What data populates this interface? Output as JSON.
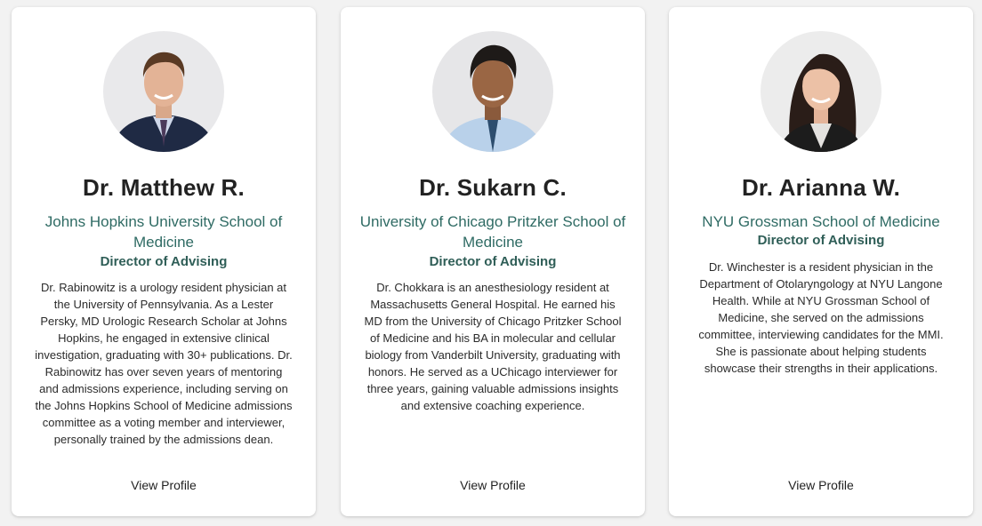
{
  "cards": [
    {
      "name": "Dr. Matthew R.",
      "school": "Johns Hopkins University School of Medicine",
      "role": "Director of Advising",
      "bio": "Dr. Rabinowitz is a urology resident physician at the University of Pennsylvania. As a Lester Persky, MD Urologic Research Scholar at Johns Hopkins, he engaged in extensive clinical investigation, graduating with 30+ publications. Dr. Rabinowitz has over seven years of mentoring and admissions experience, including serving on the Johns Hopkins School of Medicine admissions committee as a voting member and interviewer, personally trained by the admissions dean.",
      "link": "View Profile"
    },
    {
      "name": "Dr. Sukarn C.",
      "school": "University of Chicago Pritzker School of Medicine",
      "role": "Director of Advising",
      "bio": "Dr. Chokkara is an anesthesiology resident at Massachusetts General Hospital. He earned his MD from the University of Chicago Pritzker School of Medicine and his BA in molecular and cellular biology from Vanderbilt University, graduating with honors. He served as a UChicago interviewer for three years, gaining valuable admissions insights and extensive coaching experience.",
      "link": "View Profile"
    },
    {
      "name": "Dr. Arianna W.",
      "school": "NYU Grossman School of Medicine",
      "role": "Director of Advising",
      "bio": "Dr. Winchester is a resident physician in the Department of Otolaryngology at NYU Langone Health. While at NYU Grossman School of Medicine, she served on the admissions committee, interviewing candidates for the MMI. She is passionate about helping students showcase their strengths in their applications.",
      "link": "View Profile"
    }
  ]
}
